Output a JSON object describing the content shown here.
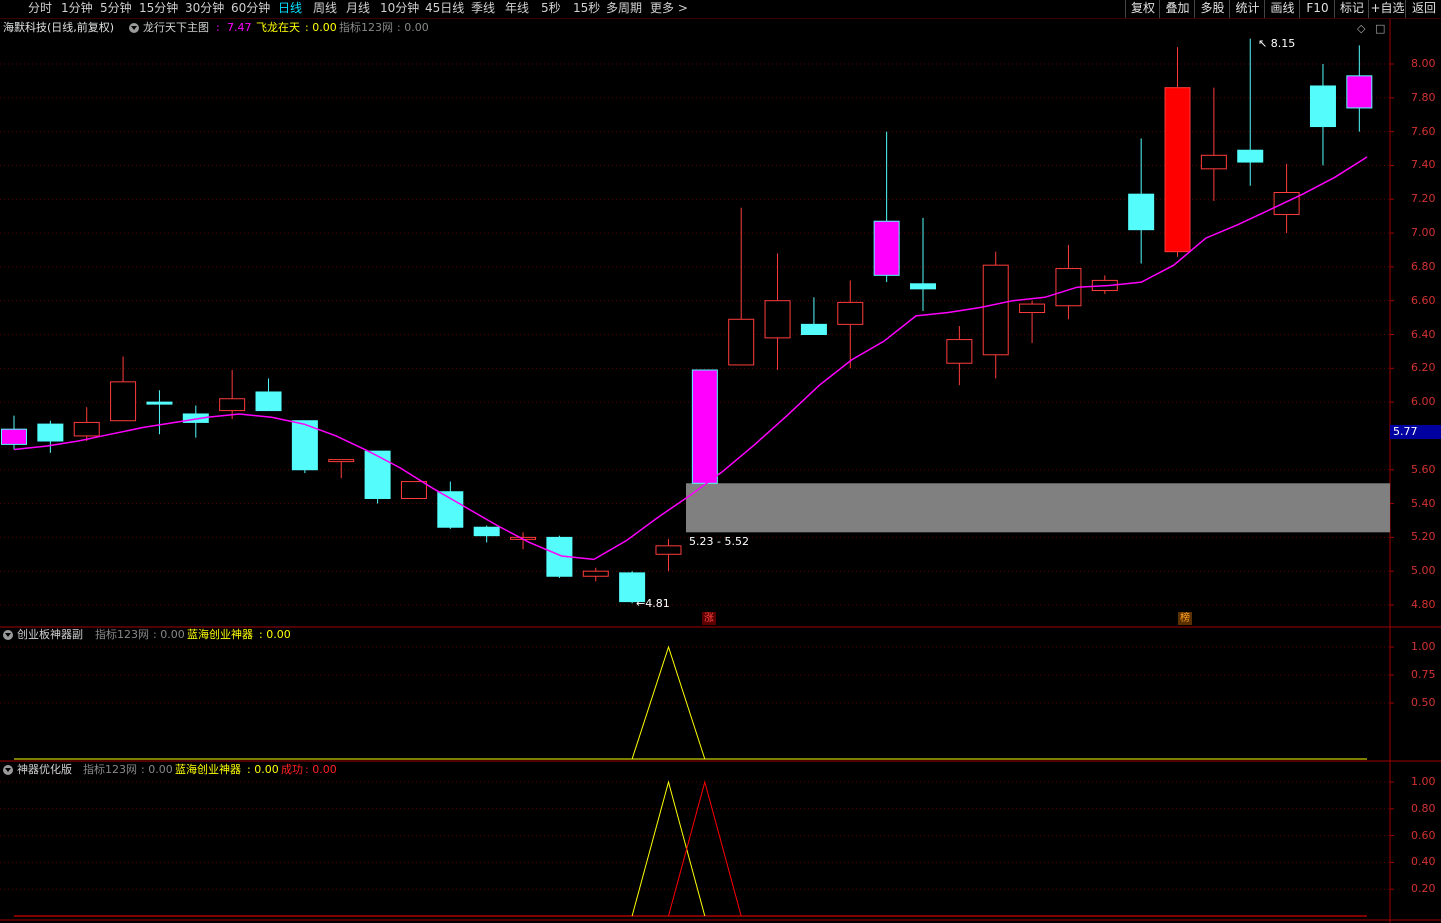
{
  "toolbar": {
    "periods": [
      "分时",
      "1分钟",
      "5分钟",
      "15分钟",
      "30分钟",
      "60分钟",
      "日线",
      "周线",
      "月线",
      "10分钟",
      "45日线",
      "季线",
      "年线",
      "5秒",
      "15秒",
      "多周期",
      "更多 >"
    ],
    "active_period": "日线",
    "right_buttons": [
      "复权",
      "叠加",
      "多股",
      "统计",
      "画线",
      "F10",
      "标记",
      "+自选",
      "返回"
    ]
  },
  "main_panel": {
    "stock_name": "海默科技(日线,前复权)",
    "indicator_name": "龙行天下主图",
    "indicator_value_sep": " : ",
    "indicator_value": "7.47",
    "line2_label": "飞龙在天",
    "line2_value": ": 0.00",
    "line3_label": "指标123网",
    "line3_value": ": 0.00",
    "y_labels": [
      "8.00",
      "7.80",
      "7.60",
      "7.40",
      "7.20",
      "7.00",
      "6.80",
      "6.60",
      "6.40",
      "6.20",
      "6.00",
      "5.60",
      "5.40",
      "5.20",
      "5.00",
      "4.80"
    ],
    "current_price": "5.77",
    "max_label": "8.15",
    "min_label": "4.81",
    "zone_label": "5.23 - 5.52",
    "marker_zhang": "涨",
    "marker_bang": "榜",
    "window_icons": [
      "◇",
      "□"
    ]
  },
  "sub_panel_1": {
    "name": "创业板神器副",
    "label1": "指标123网",
    "value1": ": 0.00",
    "label2": "蓝海创业神器",
    "value2": ": 0.00",
    "y_labels": [
      "1.00",
      "0.75",
      "0.50"
    ]
  },
  "sub_panel_2": {
    "name": "神器优化版",
    "label1": "指标123网",
    "value1": ": 0.00",
    "label2": "蓝海创业神器",
    "value2": ": 0.00",
    "label3": "成功",
    "value3": ": 0.00",
    "y_labels": [
      "1.00",
      "0.80",
      "0.60",
      "0.40",
      "0.20"
    ]
  },
  "colors": {
    "up": "#ff3c3c",
    "down": "#54fcfc",
    "limit_up": "#ff00ff",
    "ma": "#ff00ff",
    "grid": "#5a0000",
    "axis": "#a00000",
    "zone": "#808080",
    "yellow": "#ffff00",
    "red_line": "#ff0000"
  },
  "chart_data": [
    {
      "type": "candlestick",
      "ylim": [
        4.7,
        8.2
      ],
      "candles": [
        {
          "o": 5.75,
          "h": 5.92,
          "l": 5.72,
          "c": 5.84,
          "kind": "limit"
        },
        {
          "o": 5.87,
          "h": 5.89,
          "l": 5.7,
          "c": 5.77,
          "kind": "down"
        },
        {
          "o": 5.8,
          "h": 5.97,
          "l": 5.77,
          "c": 5.88,
          "kind": "up"
        },
        {
          "o": 5.89,
          "h": 6.27,
          "l": 5.89,
          "c": 6.12,
          "kind": "up"
        },
        {
          "o": 6.0,
          "h": 6.07,
          "l": 5.81,
          "c": 5.99,
          "kind": "down"
        },
        {
          "o": 5.93,
          "h": 5.98,
          "l": 5.79,
          "c": 5.88,
          "kind": "down"
        },
        {
          "o": 5.95,
          "h": 6.19,
          "l": 5.9,
          "c": 6.02,
          "kind": "up"
        },
        {
          "o": 6.06,
          "h": 6.14,
          "l": 5.95,
          "c": 5.95,
          "kind": "down"
        },
        {
          "o": 5.89,
          "h": 5.89,
          "l": 5.58,
          "c": 5.6,
          "kind": "down"
        },
        {
          "o": 5.66,
          "h": 5.66,
          "l": 5.55,
          "c": 5.65,
          "kind": "up"
        },
        {
          "o": 5.71,
          "h": 5.71,
          "l": 5.4,
          "c": 5.43,
          "kind": "down"
        },
        {
          "o": 5.43,
          "h": 5.53,
          "l": 5.43,
          "c": 5.53,
          "kind": "up"
        },
        {
          "o": 5.47,
          "h": 5.53,
          "l": 5.25,
          "c": 5.26,
          "kind": "down"
        },
        {
          "o": 5.26,
          "h": 5.27,
          "l": 5.17,
          "c": 5.21,
          "kind": "down"
        },
        {
          "o": 5.19,
          "h": 5.23,
          "l": 5.13,
          "c": 5.2,
          "kind": "up"
        },
        {
          "o": 5.2,
          "h": 5.21,
          "l": 4.96,
          "c": 4.97,
          "kind": "down"
        },
        {
          "o": 4.97,
          "h": 5.02,
          "l": 4.94,
          "c": 5.0,
          "kind": "up"
        },
        {
          "o": 4.99,
          "h": 5.0,
          "l": 4.81,
          "c": 4.82,
          "kind": "down"
        },
        {
          "o": 5.1,
          "h": 5.19,
          "l": 5.0,
          "c": 5.15,
          "kind": "up"
        },
        {
          "o": 5.52,
          "h": 6.19,
          "l": 5.52,
          "c": 6.19,
          "kind": "limit"
        },
        {
          "o": 6.22,
          "h": 7.15,
          "l": 6.22,
          "c": 6.49,
          "kind": "up"
        },
        {
          "o": 6.38,
          "h": 6.88,
          "l": 6.19,
          "c": 6.6,
          "kind": "up"
        },
        {
          "o": 6.46,
          "h": 6.62,
          "l": 6.4,
          "c": 6.4,
          "kind": "down"
        },
        {
          "o": 6.46,
          "h": 6.72,
          "l": 6.2,
          "c": 6.59,
          "kind": "up"
        },
        {
          "o": 7.07,
          "h": 7.6,
          "l": 6.71,
          "c": 6.75,
          "kind": "limit"
        },
        {
          "o": 6.7,
          "h": 7.09,
          "l": 6.54,
          "c": 6.67,
          "kind": "down"
        },
        {
          "o": 6.23,
          "h": 6.45,
          "l": 6.1,
          "c": 6.37,
          "kind": "up"
        },
        {
          "o": 6.28,
          "h": 6.89,
          "l": 6.14,
          "c": 6.81,
          "kind": "up"
        },
        {
          "o": 6.53,
          "h": 6.6,
          "l": 6.35,
          "c": 6.58,
          "kind": "up"
        },
        {
          "o": 6.57,
          "h": 6.93,
          "l": 6.49,
          "c": 6.79,
          "kind": "up"
        },
        {
          "o": 6.66,
          "h": 6.75,
          "l": 6.64,
          "c": 6.72,
          "kind": "up"
        },
        {
          "o": 7.23,
          "h": 7.56,
          "l": 6.82,
          "c": 7.02,
          "kind": "down"
        },
        {
          "o": 6.89,
          "h": 8.1,
          "l": 6.86,
          "c": 7.86,
          "kind": "limitred"
        },
        {
          "o": 7.38,
          "h": 7.86,
          "l": 7.19,
          "c": 7.46,
          "kind": "up"
        },
        {
          "o": 7.49,
          "h": 8.15,
          "l": 7.28,
          "c": 7.42,
          "kind": "down"
        },
        {
          "o": 7.11,
          "h": 7.41,
          "l": 7.0,
          "c": 7.24,
          "kind": "up"
        },
        {
          "o": 7.87,
          "h": 8.0,
          "l": 7.4,
          "c": 7.63,
          "kind": "down"
        },
        {
          "o": 7.74,
          "h": 8.11,
          "l": 7.6,
          "c": 7.93,
          "kind": "limit"
        }
      ],
      "ma_line": [
        5.72,
        5.74,
        5.77,
        5.81,
        5.85,
        5.88,
        5.91,
        5.93,
        5.91,
        5.87,
        5.8,
        5.71,
        5.61,
        5.49,
        5.38,
        5.27,
        5.17,
        5.09,
        5.07,
        5.18,
        5.32,
        5.45,
        5.59,
        5.75,
        5.92,
        6.1,
        6.25,
        6.36,
        6.51,
        6.53,
        6.56,
        6.6,
        6.62,
        6.68,
        6.69,
        6.71,
        6.81,
        6.97,
        7.05,
        7.14,
        7.23,
        7.33,
        7.45
      ],
      "zone": [
        5.23,
        5.52
      ]
    },
    {
      "type": "line",
      "ylim": [
        0,
        1.05
      ],
      "series": [
        {
          "values_at": [
            [
              17,
              0
            ],
            [
              18,
              1
            ],
            [
              19,
              0
            ]
          ]
        }
      ]
    },
    {
      "type": "line",
      "ylim": [
        0,
        1.05
      ],
      "series": [
        {
          "values_at": [
            [
              17,
              0
            ],
            [
              18,
              1
            ],
            [
              19,
              0
            ]
          ]
        },
        {
          "values_at": [
            [
              18,
              0
            ],
            [
              19,
              1
            ],
            [
              20,
              0
            ]
          ]
        }
      ]
    }
  ]
}
